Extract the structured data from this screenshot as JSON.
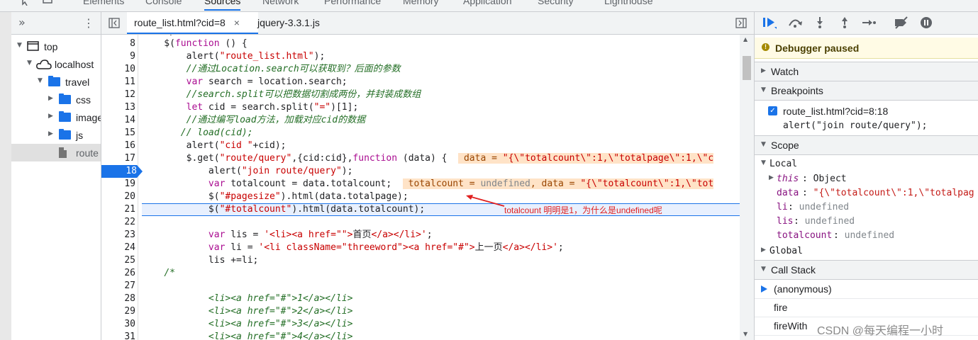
{
  "devtools_tabs": [
    "Elements",
    "Console",
    "Sources",
    "Network",
    "Performance",
    "Memory",
    "Application",
    "Security",
    "Lighthouse"
  ],
  "active_tab": "Sources",
  "navigator": {
    "items": [
      {
        "label": "top",
        "type": "frame"
      },
      {
        "label": "localhost",
        "type": "origin"
      },
      {
        "label": "travel",
        "type": "folder"
      },
      {
        "label": "css",
        "type": "folder"
      },
      {
        "label": "image",
        "type": "folder"
      },
      {
        "label": "js",
        "type": "folder"
      },
      {
        "label": "route",
        "type": "file"
      }
    ]
  },
  "editor": {
    "tabs": [
      {
        "label": "route_list.html?cid=8",
        "close": "×"
      },
      {
        "label": "jquery-3.3.1.js"
      }
    ],
    "line_numbers": [
      "8",
      "9",
      "10",
      "11",
      "12",
      "13",
      "14",
      "15",
      "16",
      "17",
      "18",
      "19",
      "20",
      "21",
      "22",
      "23",
      "24",
      "25",
      "26",
      "27",
      "28",
      "29",
      "30",
      "31"
    ],
    "breakpoint_line": "18",
    "annotation": "totalcount 明明是1，为什么是undefined呢"
  },
  "debugger": {
    "paused": "Debugger paused",
    "sections": {
      "watch": "Watch",
      "breakpoints": "Breakpoints",
      "scope": "Scope",
      "call_stack": "Call Stack"
    },
    "breakpoint": {
      "file": "route_list.html?cid=8:18",
      "code": "alert(\"join route/query\");"
    },
    "scope": {
      "local": "Local",
      "global": "Global",
      "vars": [
        {
          "key": "this",
          "value": "Object"
        },
        {
          "key": "data",
          "value": "\"{\\\"totalcount\\\":1,\\\"totalpag"
        },
        {
          "key": "li",
          "value": "undefined"
        },
        {
          "key": "lis",
          "value": "undefined"
        },
        {
          "key": "totalcount",
          "value": "undefined"
        }
      ]
    },
    "call_stack": [
      "(anonymous)",
      "fire",
      "fireWith"
    ]
  },
  "watermark": "CSDN @每天编程一小时",
  "colors": {
    "accent": "#1a73e8",
    "paused_bg": "#fffbe5",
    "annotation": "#e02020"
  }
}
